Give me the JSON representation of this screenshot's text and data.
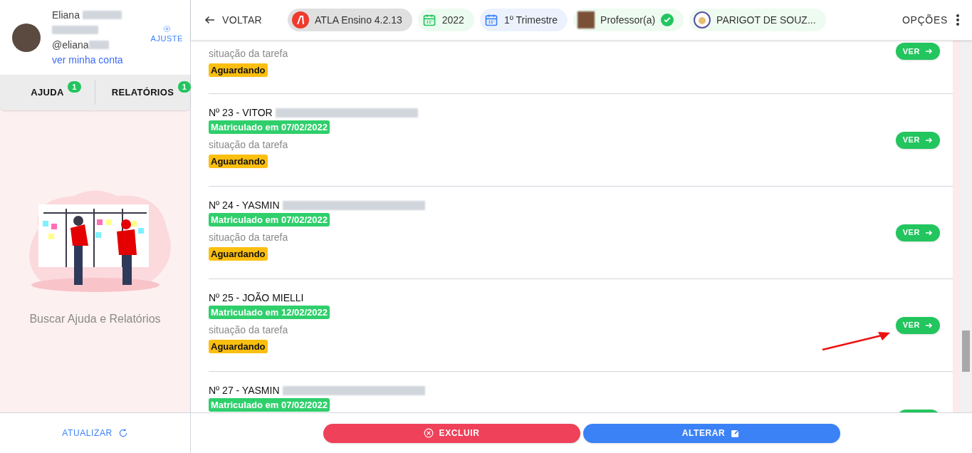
{
  "user": {
    "first_name": "Eliana",
    "handle": "@eliana",
    "account_link": "ver minha conta",
    "settings_label": "AJUSTE"
  },
  "side_tabs": [
    {
      "label": "AJUDA",
      "count": "1",
      "selected": false
    },
    {
      "label": "RELATÓRIOS",
      "count": "1",
      "selected": false
    }
  ],
  "empty_state": {
    "caption": "Buscar Ajuda e Relatórios"
  },
  "refresh_label": "ATUALIZAR",
  "top_bar": {
    "back_label": "VOLTAR",
    "chips": [
      {
        "kind": "app",
        "label": "ATLA Ensino 4.2.13"
      },
      {
        "kind": "year",
        "label": "2022"
      },
      {
        "kind": "term",
        "label": "1º Trimestre"
      },
      {
        "kind": "role",
        "label": "Professor(a)"
      },
      {
        "kind": "school",
        "label": "PARIGOT DE SOUZ..."
      }
    ],
    "options_label": "OPÇÕES"
  },
  "students": [
    {
      "status_label": "situação da tarefa",
      "status": "Aguardando",
      "action": "VER"
    },
    {
      "name": "Nº 23 - VITOR",
      "name_blurred": true,
      "enrolled": "Matriculado em 07/02/2022",
      "status_label": "situação da tarefa",
      "status": "Aguardando",
      "action": "VER"
    },
    {
      "name": "Nº 24 - YASMIN",
      "name_blurred": true,
      "enrolled": "Matriculado em 07/02/2022",
      "status_label": "situação da tarefa",
      "status": "Aguardando",
      "action": "VER"
    },
    {
      "name": "Nº 25 - JOÃO MIELLI",
      "name_blurred": false,
      "enrolled": "Matriculado em 12/02/2022",
      "status_label": "situação da tarefa",
      "status": "Aguardando",
      "action": "VER"
    },
    {
      "name": "Nº 27 - YASMIN",
      "name_blurred": true,
      "enrolled": "Matriculado em 07/02/2022"
    }
  ],
  "footer_buttons": [
    {
      "kind": "delete",
      "label": "EXCLUIR"
    },
    {
      "kind": "edit",
      "label": "ALTERAR"
    }
  ]
}
